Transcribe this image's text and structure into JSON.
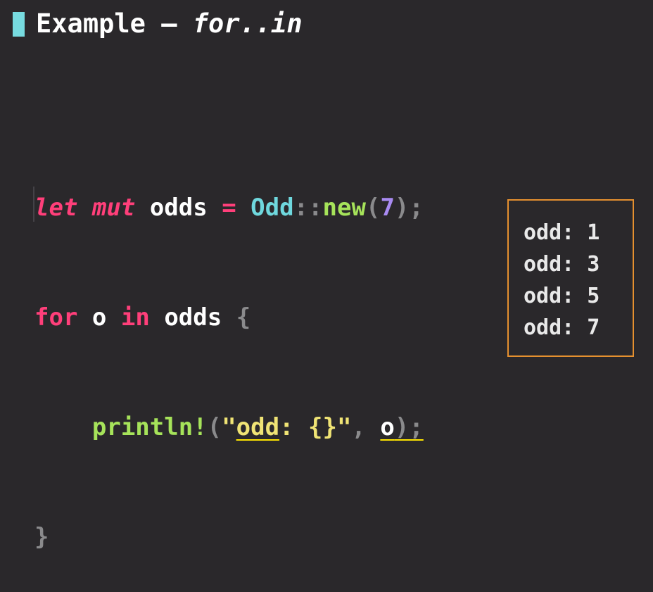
{
  "title": {
    "text_plain": "Example – ",
    "text_italic": "for..in"
  },
  "code": {
    "line1": {
      "kw_let": "let",
      "kw_mut": "mut",
      "var": "odds",
      "op": "=",
      "type": "Odd",
      "sep": "::",
      "fn": "new",
      "open": "(",
      "num": "7",
      "close": ");"
    },
    "line2": {
      "kw_for": "for",
      "var_o": "o",
      "kw_in": "in",
      "var_odds": "odds",
      "brace": "{"
    },
    "line3": {
      "macro": "println!",
      "open": "(",
      "quote_open": "\"",
      "str_highlight": "odd",
      "str_rest": ": {}",
      "quote_close": "\"",
      "comma": ", ",
      "arg": "o",
      "close": ");"
    },
    "line4": {
      "brace": "}"
    }
  },
  "output": {
    "lines": [
      "odd: 1",
      "odd: 3",
      "odd: 5",
      "odd: 7"
    ]
  },
  "colors": {
    "background": "#2a282b",
    "accent_bar": "#77dbe0",
    "keyword": "#ff3f7a",
    "type": "#6fd8de",
    "function": "#a6e35a",
    "number": "#a98bf2",
    "string": "#f0e475",
    "underline_highlight": "#ffe600",
    "output_border": "#e5902f"
  }
}
